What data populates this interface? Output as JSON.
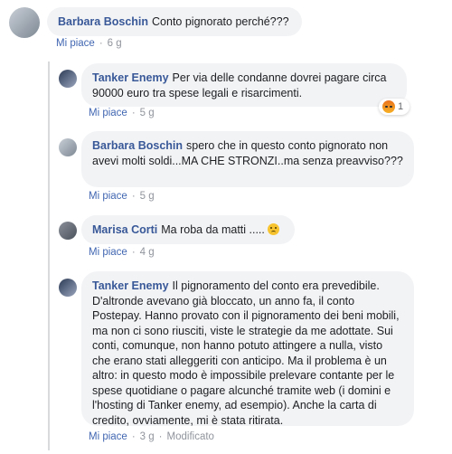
{
  "comments": [
    {
      "author": "Barbara Boschin",
      "text": "Conto pignorato perché???",
      "like": "Mi piace",
      "age": "6 g"
    },
    {
      "author": "Tanker Enemy",
      "text": "Per via delle condanne dovrei pagare circa 90000 euro tra spese legali e risarcimenti.",
      "like": "Mi piace",
      "age": "5 g",
      "reaction_count": "1",
      "reaction_icon": "angry-reaction-icon"
    },
    {
      "author": "Barbara Boschin",
      "text": "spero che in questo conto pignorato non avevi molti soldi...MA CHE STRONZI..ma senza preavviso???",
      "like": "Mi piace",
      "age": "5 g"
    },
    {
      "author": "Marisa Corti",
      "text": "Ma roba da matti .....",
      "like": "Mi piace",
      "age": "4 g",
      "emoji": "sad-face-emoji"
    },
    {
      "author": "Tanker Enemy",
      "text": "Il pignoramento del conto era prevedibile. D'altronde avevano già bloccato, un anno fa, il conto Postepay. Hanno provato con il pignoramento dei beni mobili, ma non ci sono riusciti, viste le strategie da me adottate. Sui conti, comunque, non hanno potuto attingere a nulla, visto che erano stati alleggeriti con anticipo. Ma il problema è un altro: in questo modo è impossibile prelevare contante per le spese quotidiane o pagare alcunché tramite web (i domini e l'hosting di Tanker enemy, ad esempio). Anche la carta di credito, ovviamente, mi è stata ritirata.",
      "like": "Mi piace",
      "age": "3 g",
      "edited": "Modificato"
    }
  ],
  "colors": {
    "author": "#385898",
    "like": "#4267b2",
    "bubble": "#f2f3f5",
    "meta": "#90949c"
  }
}
